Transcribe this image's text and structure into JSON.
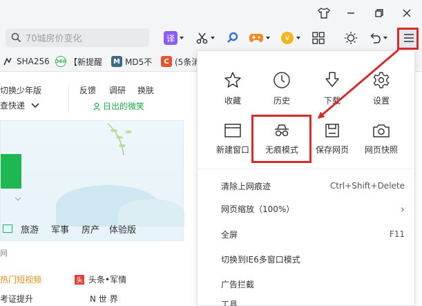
{
  "toolbar": {
    "search_placeholder": "70城房价变化",
    "translate_label": "译"
  },
  "bookmarks": [
    {
      "label": "SHA256",
      "icon": "sha-icon"
    },
    {
      "label": "【新提醒",
      "icon": "360-icon",
      "icon_text": "360"
    },
    {
      "label": "MD5不",
      "icon": "m-icon",
      "icon_text": "M"
    },
    {
      "label": "(5条消",
      "icon": "c-icon",
      "icon_text": "C"
    }
  ],
  "page": {
    "switch_teen": "切换少年版",
    "quick_check": "查快递",
    "feedback": "反馈",
    "survey": "调研",
    "change_skin": "换肤",
    "user_name": "日出的微笑",
    "nav": [
      "旅游",
      "军事",
      "房产",
      "体验版"
    ],
    "section_label": "网",
    "hot_video": "热门短视频",
    "headline_tag": "头",
    "headline": "头条•军情",
    "exam": "考证提升",
    "world": "N 世 界"
  },
  "menu": {
    "grid": [
      {
        "label": "收藏",
        "icon": "star-icon"
      },
      {
        "label": "历史",
        "icon": "clock-icon"
      },
      {
        "label": "下载",
        "icon": "download-icon"
      },
      {
        "label": "设置",
        "icon": "gear-icon"
      },
      {
        "label": "新建窗口",
        "icon": "new-window-icon"
      },
      {
        "label": "无痕模式",
        "icon": "incognito-icon"
      },
      {
        "label": "保存网页",
        "icon": "save-page-icon"
      },
      {
        "label": "网页快照",
        "icon": "camera-icon"
      }
    ],
    "items": [
      {
        "label": "清除上网痕迹",
        "shortcut": "Ctrl+Shift+Delete"
      },
      {
        "label": "网页缩放（100%）",
        "shortcut": "›"
      },
      {
        "label": "全屏",
        "shortcut": "F11"
      },
      {
        "label": "切换到IE6多窗口模式",
        "shortcut": ""
      },
      {
        "label": "广告拦截",
        "shortcut": ""
      },
      {
        "label": "工具",
        "shortcut": ""
      }
    ]
  },
  "colors": {
    "highlight": "#d52a2a",
    "accent_green": "#1fb754"
  }
}
